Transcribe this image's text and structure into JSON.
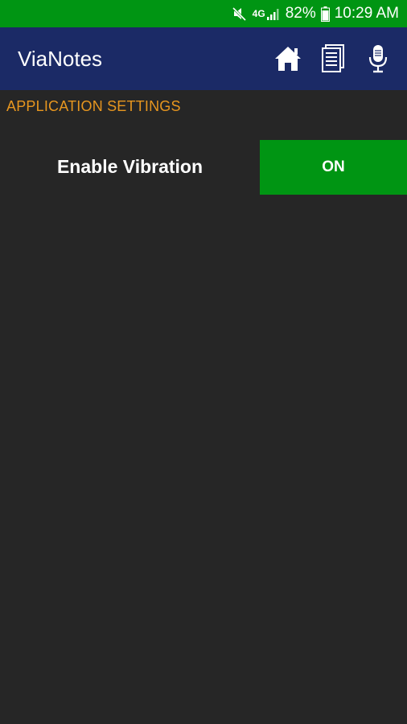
{
  "status_bar": {
    "network": "4G",
    "battery": "82%",
    "time": "10:29 AM",
    "icons": [
      "mute-icon",
      "signal-icon",
      "battery-icon"
    ]
  },
  "app_bar": {
    "title": "ViaNotes",
    "actions": [
      {
        "icon": "home-icon"
      },
      {
        "icon": "notes-icon"
      },
      {
        "icon": "microphone-icon"
      }
    ]
  },
  "settings": {
    "section_title": "APPLICATION SETTINGS",
    "items": [
      {
        "label": "Enable Vibration",
        "toggle": "ON"
      }
    ]
  },
  "colors": {
    "status_bar": "#009513",
    "app_bar": "#1b2a66",
    "background": "#262626",
    "section_header": "#e7961f",
    "toggle_on": "#009513"
  }
}
